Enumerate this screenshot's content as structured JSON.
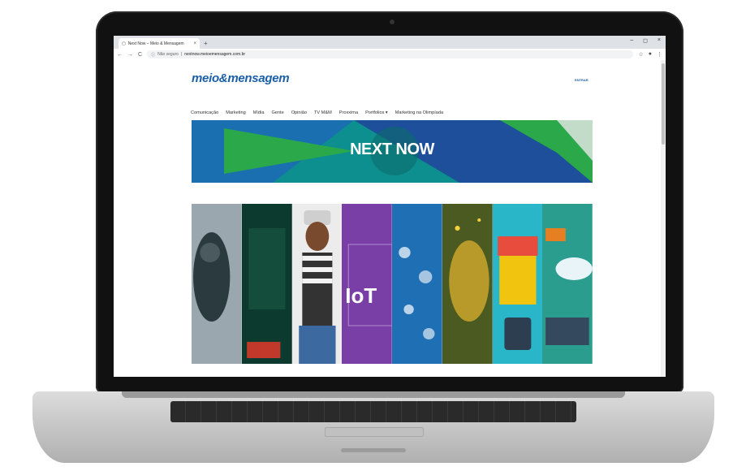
{
  "browser": {
    "tab_title": "Next Now – Meio & Mensagem",
    "tab_close": "×",
    "new_tab": "+",
    "nav_back": "←",
    "nav_forward": "→",
    "reload": "C",
    "security_label": "Não seguro",
    "url": "nextnow.meioemensagem.com.br",
    "window_controls": [
      "–",
      "◻",
      "×"
    ]
  },
  "site": {
    "logo": "meio&mensagem",
    "login_label": "ENTRAR",
    "nav": [
      "Comunicação",
      "Marketing",
      "Mídia",
      "Gente",
      "Opinião",
      "TV M&M",
      "Proxxima",
      "Portfolios ▾",
      "Marketing na Olimpíada"
    ],
    "banner_title": "NEXT NOW",
    "iot_label": "IoT",
    "mosaic_panel_count": 8
  },
  "colors": {
    "brand_blue": "#1b5fa8",
    "banner_teal": "#0e8f8f",
    "banner_green": "#2aa84a",
    "iot_purple": "#7a3fa6"
  }
}
